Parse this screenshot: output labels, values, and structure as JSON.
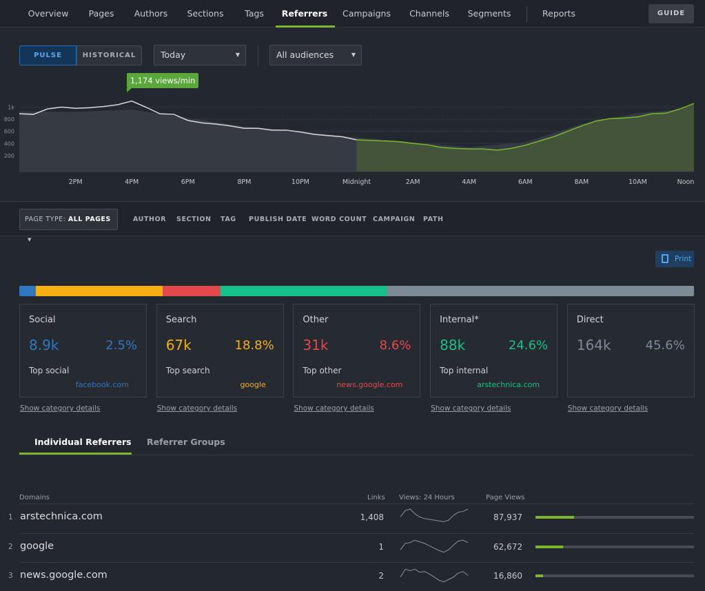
{
  "nav": {
    "tabs": [
      "Overview",
      "Pages",
      "Authors",
      "Sections",
      "Tags",
      "Referrers",
      "Campaigns",
      "Channels",
      "Segments",
      "Reports"
    ],
    "active": "Referrers",
    "guide": "GUIDE"
  },
  "controls": {
    "pulse": "PULSE",
    "historical": "HISTORICAL",
    "period": "Today",
    "audience": "All audiences",
    "period_icon": "caret-down-icon"
  },
  "chart_data": {
    "type": "area",
    "tooltip": "1,174 views/min",
    "y_ticks": [
      "1k",
      "800",
      "600",
      "400",
      "200"
    ],
    "x_ticks": [
      "2PM",
      "4PM",
      "6PM",
      "8PM",
      "10PM",
      "Midnight",
      "2AM",
      "4AM",
      "6AM",
      "8AM",
      "10AM",
      "Noon"
    ],
    "ylim": [
      0,
      1200
    ],
    "grid": true,
    "x_step": "30 min",
    "x_start": "12PM",
    "series": [
      {
        "values": [
          890,
          880,
          970,
          1000,
          980,
          990,
          1010,
          1040,
          1100,
          1000,
          890,
          880,
          780,
          740,
          720,
          690,
          650,
          650,
          620,
          620,
          590,
          550,
          530,
          510,
          460,
          450,
          440,
          430,
          400,
          380,
          335,
          320,
          310,
          310,
          290,
          320,
          370,
          440,
          510,
          600,
          690,
          770,
          810,
          820,
          840,
          890,
          900,
          970,
          1060
        ]
      }
    ],
    "comparison": {
      "x_step": "2 hours",
      "values": [
        930,
        920,
        960,
        820,
        680,
        600,
        500,
        420,
        340,
        420,
        720,
        900,
        980
      ]
    },
    "colors": {
      "past": "#d9d9d9",
      "today": "#7cb82f",
      "tooltip": "#5aa83c"
    }
  },
  "filters": {
    "page_type_label": "PAGE TYPE:",
    "page_type_value": "ALL PAGES",
    "items": [
      "AUTHOR",
      "SECTION",
      "TAG",
      "PUBLISH DATE",
      "WORD COUNT",
      "CAMPAIGN",
      "PATH"
    ]
  },
  "print": "Print",
  "categories": [
    {
      "title": "Social",
      "count": "8.9k",
      "pct": "2.5%",
      "share": 2.5,
      "top_label": "Top social",
      "top": "facebook.com",
      "color": "#2f78c4",
      "link": "Show category details"
    },
    {
      "title": "Search",
      "count": "67k",
      "pct": "18.8%",
      "share": 18.8,
      "top_label": "Top search",
      "top": "google",
      "color": "#f6b012",
      "link": "Show category details"
    },
    {
      "title": "Other",
      "count": "31k",
      "pct": "8.6%",
      "share": 8.6,
      "top_label": "Top other",
      "top": "news.google.com",
      "color": "#e5484b",
      "link": "Show category details"
    },
    {
      "title": "Internal*",
      "count": "88k",
      "pct": "24.6%",
      "share": 24.6,
      "top_label": "Top internal",
      "top": "arstechnica.com",
      "color": "#15c08a",
      "link": "Show category details"
    },
    {
      "title": "Direct",
      "count": "164k",
      "pct": "45.6%",
      "share": 45.6,
      "top_label": "",
      "top": "",
      "color": "#7d8b96",
      "link": "Show category details"
    }
  ],
  "ref_tabs": {
    "individual": "Individual Referrers",
    "groups": "Referrer Groups"
  },
  "table": {
    "headers": {
      "domains": "Domains",
      "links": "Links",
      "views24": "Views: 24 Hours",
      "pageviews": "Page Views"
    },
    "rows": [
      {
        "rank": "1",
        "domain": "arstechnica.com",
        "links": "1,408",
        "pageviews": "87,937",
        "share": 0.245,
        "spark": [
          5,
          9,
          10,
          7,
          5,
          4,
          3.5,
          3,
          2.5,
          2,
          3,
          6,
          8,
          8.5,
          10
        ]
      },
      {
        "rank": "2",
        "domain": "google",
        "links": "1",
        "pageviews": "62,672",
        "share": 0.175,
        "spark": [
          3,
          7,
          7.5,
          9,
          8,
          7,
          5.5,
          4,
          2.5,
          1.5,
          3,
          6,
          8.5,
          9,
          7.5
        ]
      },
      {
        "rank": "3",
        "domain": "news.google.com",
        "links": "2",
        "pageviews": "16,860",
        "share": 0.047,
        "spark": [
          4,
          9,
          8,
          9,
          7,
          7.5,
          6,
          4,
          2,
          1,
          2.5,
          4,
          6.5,
          7.5,
          5
        ]
      }
    ]
  }
}
